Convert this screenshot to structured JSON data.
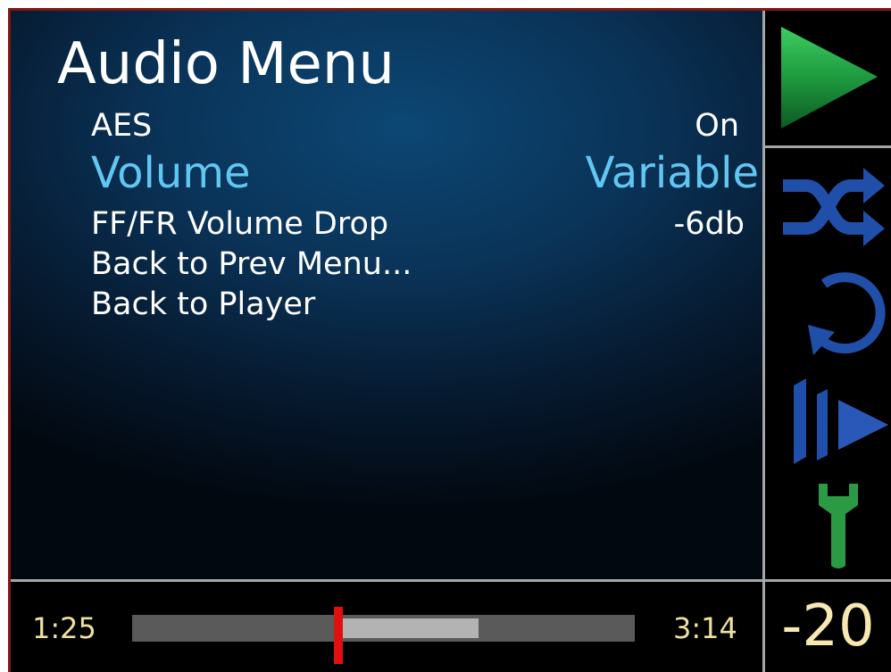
{
  "menu": {
    "title": "Audio Menu",
    "items": [
      {
        "label": "AES",
        "value": "On"
      },
      {
        "label": "Volume",
        "value": "Variable"
      },
      {
        "label": "FF/FR Volume Drop",
        "value": "-6db"
      },
      {
        "label": "Back to Prev Menu...",
        "value": ""
      },
      {
        "label": "Back to Player",
        "value": ""
      }
    ],
    "selected_index": 1
  },
  "sidebar": {
    "icons": [
      "play-icon",
      "shuffle-icon",
      "repeat-icon",
      "skip-forward-icon",
      "wrench-icon"
    ]
  },
  "playback": {
    "elapsed": "1:25",
    "total": "3:14",
    "volume": "-20",
    "buffered_start_fraction": 0.41,
    "buffered_end_fraction": 0.69
  },
  "colors": {
    "title_text": "#ffffff",
    "menu_text": "#ffffff",
    "selected_text": "#62c6f2",
    "play_green": "#1e9a3e",
    "control_blue": "#1f4fa8",
    "wrench_green": "#2a9a44",
    "time_text": "#f0e0a0",
    "playhead_red": "#e01010"
  }
}
